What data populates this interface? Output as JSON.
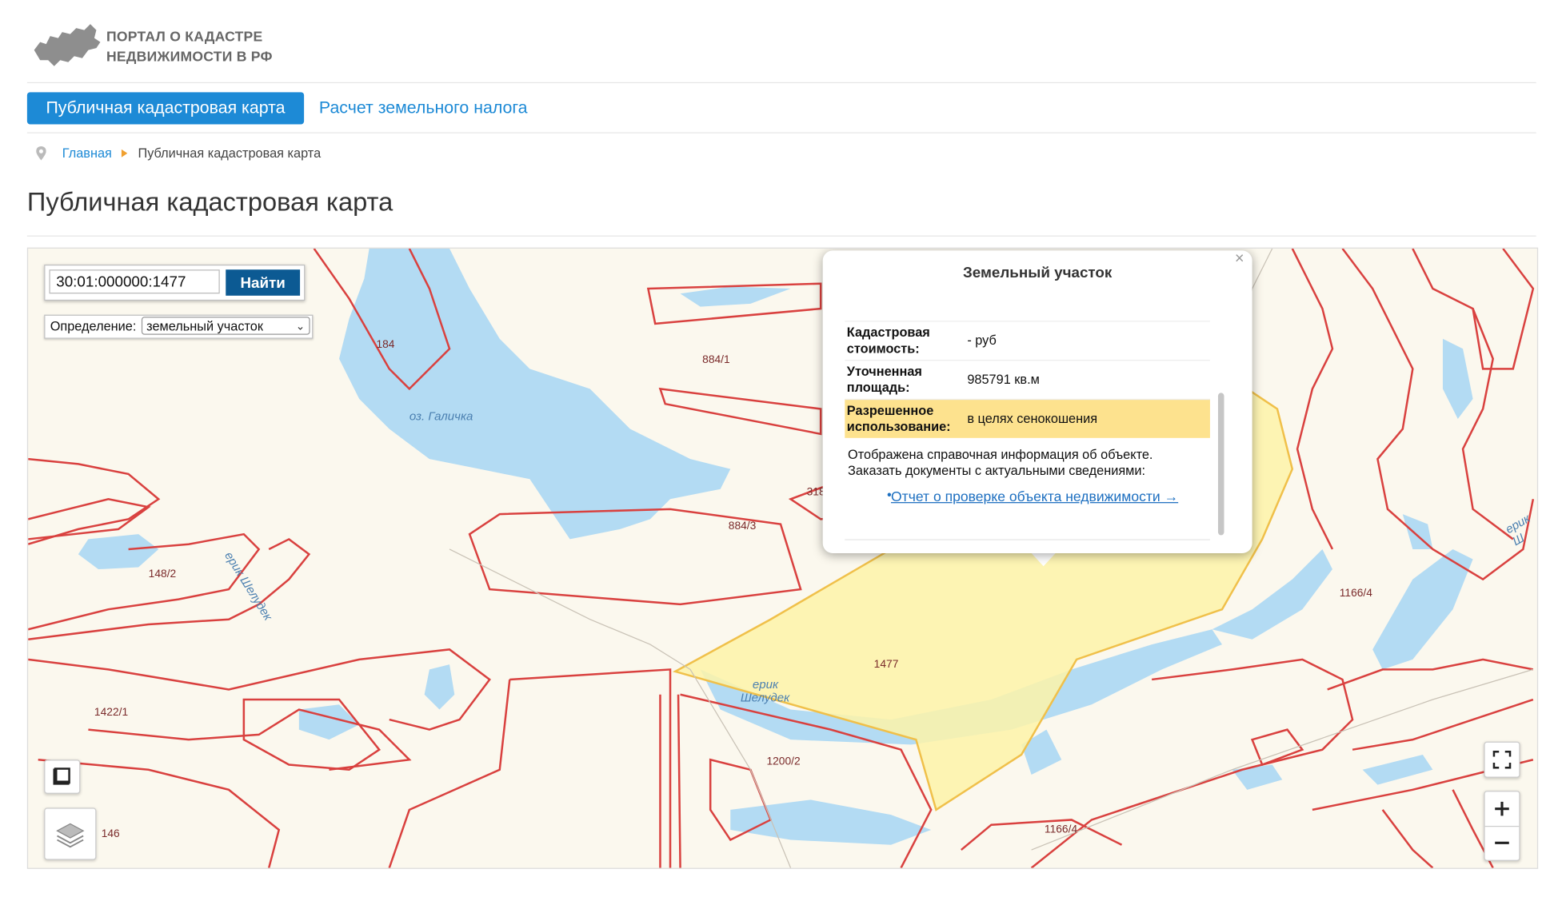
{
  "header": {
    "portal_line1": "ПОРТАЛ О КАДАСТРЕ",
    "portal_line2": "НЕДВИЖИМОСТИ В РФ"
  },
  "nav": {
    "tabs": [
      {
        "label": "Публичная кадастровая карта",
        "active": true
      },
      {
        "label": "Расчет земельного налога",
        "active": false
      }
    ]
  },
  "breadcrumb": {
    "home": "Главная",
    "current": "Публичная кадастровая карта"
  },
  "page": {
    "title": "Публичная кадастровая карта"
  },
  "map": {
    "search": {
      "value": "30:01:000000:1477",
      "button": "Найти"
    },
    "definition": {
      "label": "Определение:",
      "selected": "земельный участок"
    },
    "parcel_labels": [
      "184",
      "884/1",
      "884/3",
      "318",
      "148/2",
      "1477",
      "1166/4",
      "1422/1",
      "1200/2",
      "146",
      "1166/4"
    ],
    "water_labels": [
      "оз. Галичка",
      "ерик Шелудек",
      "ерик",
      "Шелудек",
      "ерик Ш"
    ],
    "colors": {
      "parcel_line": "#d9413f",
      "water": "#b3dbf3",
      "selected_fill": "#fdf3a8",
      "background": "#fbf8ee"
    }
  },
  "popup": {
    "title": "Земельный участок",
    "rows": [
      {
        "key": "Кадастровая стоимость:",
        "value": "- руб"
      },
      {
        "key": "Уточненная площадь:",
        "value": "985791 кв.м"
      },
      {
        "key": "Разрешенное использование:",
        "value": "в целях сенокошения",
        "highlight": true
      }
    ],
    "info_line1": "Отображена справочная информация об объекте.",
    "info_line2": "Заказать документы с актуальными сведениями:",
    "link": "Отчет о проверке объекта недвижимости →"
  },
  "icons": [
    "russia-map-logo-icon",
    "location-pin-icon",
    "breadcrumb-arrow-icon",
    "close-icon",
    "draw-area-icon",
    "layers-icon",
    "fullscreen-icon",
    "zoom-in-icon",
    "zoom-out-icon"
  ]
}
